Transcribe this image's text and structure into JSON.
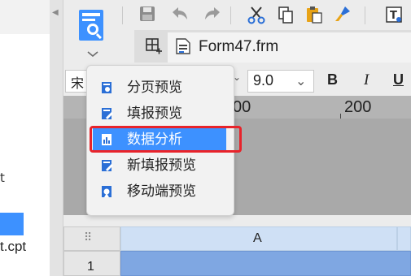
{
  "toolbar": {
    "buttons": [
      "preview-icon",
      "save-icon",
      "undo-icon",
      "redo-icon",
      "cut-icon",
      "copy-icon",
      "paste-icon",
      "format-brush-icon",
      "text-icon"
    ]
  },
  "tab": {
    "title": "Form47.frm"
  },
  "format": {
    "font_name": "宋",
    "font_size": "9.0",
    "bold": "B",
    "italic": "I",
    "underline": "U"
  },
  "ruler": {
    "mark_200": "200",
    "mark_00": "00"
  },
  "left_panel": {
    "item_t": "t",
    "file_name": "t.cpt"
  },
  "preview_menu": {
    "items": [
      {
        "label": "分页预览"
      },
      {
        "label": "填报预览"
      },
      {
        "label": "数据分析"
      },
      {
        "label": "新填报预览"
      },
      {
        "label": "移动端预览"
      }
    ],
    "selected_index": 2
  },
  "sheet": {
    "column_a": "A",
    "row_1": "1",
    "corner_glyph": "⠿"
  },
  "colors": {
    "accent": "#3d91ff",
    "highlight_outline": "#e8232a",
    "selected_cell": "#7fa7e2"
  }
}
